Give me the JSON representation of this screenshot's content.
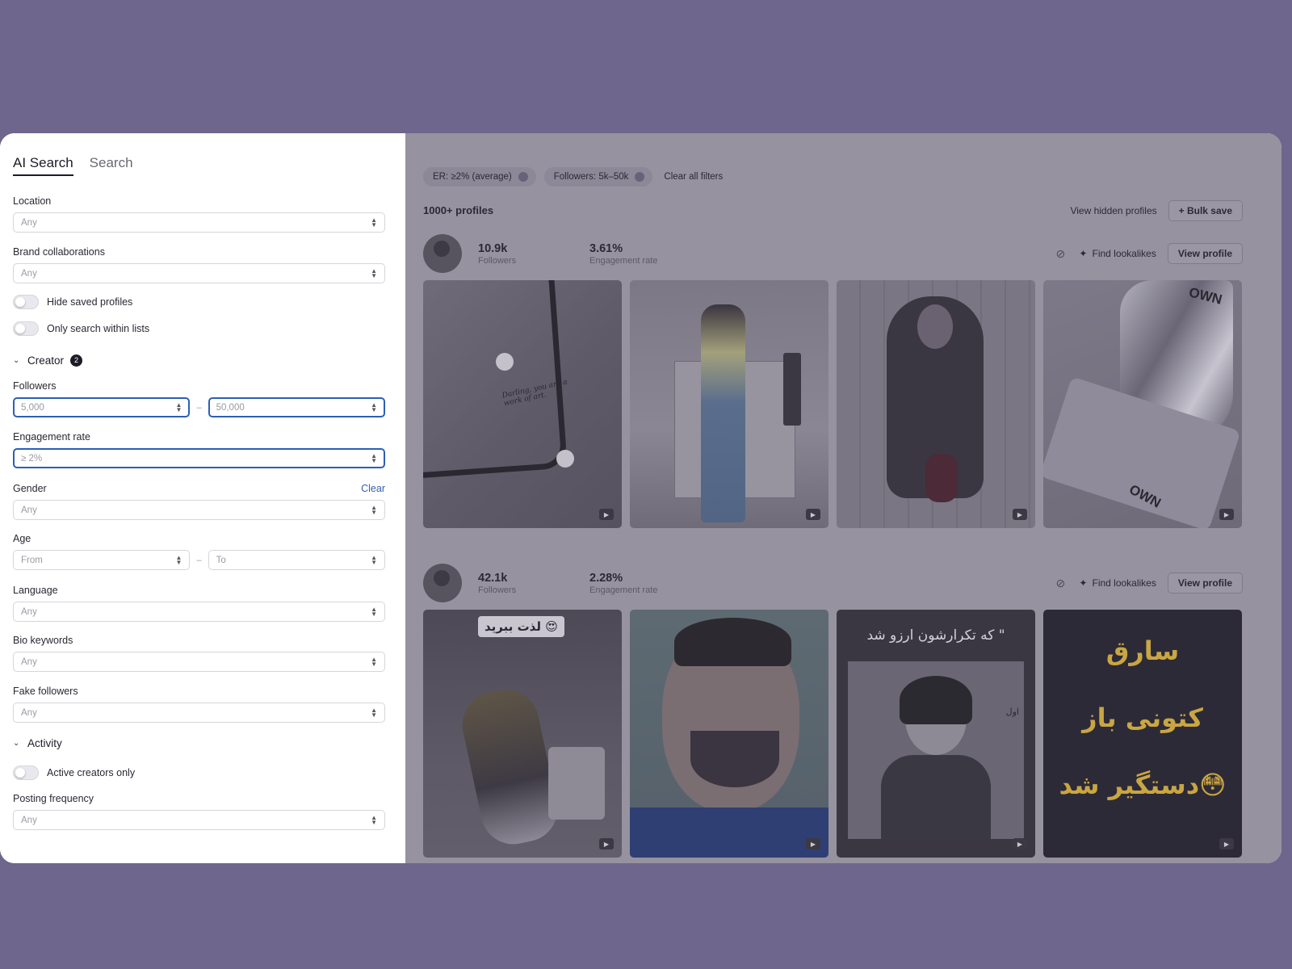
{
  "sidebar": {
    "tabs": [
      "AI Search",
      "Search"
    ],
    "location": {
      "label": "Location",
      "value": "Any"
    },
    "brand_collaborations": {
      "label": "Brand collaborations",
      "value": "Any"
    },
    "hide_saved": "Hide saved profiles",
    "only_lists": "Only search within lists",
    "creator": {
      "title": "Creator",
      "count": "2"
    },
    "followers": {
      "label": "Followers",
      "min": "5,000",
      "max": "50,000",
      "dash": "–"
    },
    "engagement": {
      "label": "Engagement rate",
      "value": "≥ 2%"
    },
    "gender": {
      "label": "Gender",
      "clear": "Clear",
      "value": "Any"
    },
    "age": {
      "label": "Age",
      "from": "From",
      "to": "To",
      "dash": "–"
    },
    "language": {
      "label": "Language",
      "value": "Any"
    },
    "bio_keywords": {
      "label": "Bio keywords",
      "value": "Any"
    },
    "fake_followers": {
      "label": "Fake followers",
      "value": "Any"
    },
    "activity": {
      "title": "Activity"
    },
    "active_only": "Active creators only",
    "posting_frequency": {
      "label": "Posting frequency",
      "value": "Any"
    }
  },
  "main": {
    "chips": [
      "ER: ≥2% (average)",
      "Followers: 5k–50k"
    ],
    "clear_all": "Clear all filters",
    "results_count": "1000+ profiles",
    "view_hidden": "View hidden profiles",
    "bulk_save": "+ Bulk save",
    "find_lookalikes": "Find lookalikes",
    "view_profile": "View profile",
    "profiles": [
      {
        "followers": "10.9k",
        "followers_label": "Followers",
        "er": "3.61%",
        "er_label": "Engagement rate"
      },
      {
        "followers": "42.1k",
        "followers_label": "Followers",
        "er": "2.28%",
        "er_label": "Engagement rate"
      }
    ],
    "thumb_text": {
      "darling": "Darling, you are a work of art.",
      "own": "OWN",
      "own2": "OWN",
      "lazat": "لذت ببرید 😍",
      "quote": "\" که تکرارشون ارزو شد",
      "sign": "اول",
      "sareq": "سارق",
      "kotoni": "کتونی باز",
      "dastgir": "دستگیر شد😳"
    }
  }
}
